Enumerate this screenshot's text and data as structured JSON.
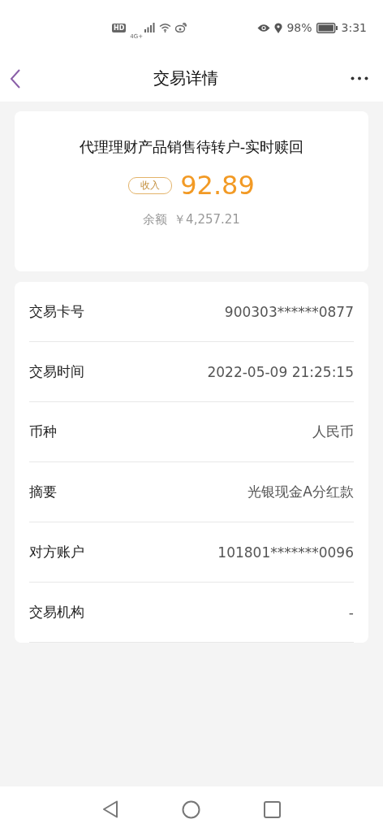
{
  "status_bar": {
    "hd": "HD",
    "network": "4G+",
    "battery": "98%",
    "time": "3:31"
  },
  "header": {
    "title": "交易详情"
  },
  "summary": {
    "description": "代理理财产品销售待转户-实时赎回",
    "type_badge": "收入",
    "amount": "92.89",
    "balance_label": "余额",
    "balance": "￥4,257.21"
  },
  "details": [
    {
      "label": "交易卡号",
      "value": "900303******0877"
    },
    {
      "label": "交易时间",
      "value": "2022-05-09 21:25:15"
    },
    {
      "label": "币种",
      "value": "人民币"
    },
    {
      "label": "摘要",
      "value": "光银现金A分红款"
    },
    {
      "label": "对方账户",
      "value": "101801*******0096"
    },
    {
      "label": "交易机构",
      "value": "-"
    }
  ]
}
